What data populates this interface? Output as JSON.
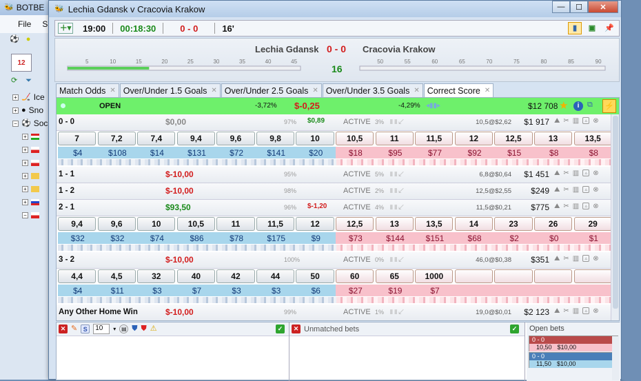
{
  "bg_window": {
    "title": "BOTBE",
    "menu": [
      "File",
      "S"
    ],
    "tree": [
      "Ice",
      "Sno",
      "Soc"
    ]
  },
  "window": {
    "title": "Lechia Gdansk v Cracovia Krakow",
    "min": "—",
    "max": "☐",
    "close": "✕"
  },
  "toolbar": {
    "start_time": "19:00",
    "elapsed": "00:18:30",
    "score": "0 - 0",
    "minute": "16'"
  },
  "scoreboard": {
    "home": "Lechia Gdansk",
    "score": "0 - 0",
    "away": "Cracovia Krakow",
    "minute": "16",
    "left_ticks": [
      "5",
      "10",
      "15",
      "20",
      "25",
      "30",
      "35",
      "40",
      "45"
    ],
    "right_ticks": [
      "50",
      "55",
      "60",
      "65",
      "70",
      "75",
      "80",
      "85",
      "90"
    ],
    "first_half_progress": 0.35,
    "second_half_progress": 0
  },
  "tabs": [
    {
      "label": "Match Odds"
    },
    {
      "label": "Over/Under 1.5 Goals"
    },
    {
      "label": "Over/Under 2.5 Goals"
    },
    {
      "label": "Over/Under 3.5 Goals"
    },
    {
      "label": "Correct Score",
      "active": true
    }
  ],
  "market_header": {
    "status": "OPEN",
    "back_pct": "-3,72%",
    "pl": "$-0,25",
    "lay_pct": "-4,29%",
    "matched": "$12 708"
  },
  "runners": [
    {
      "name": "0 - 0",
      "pl": "$0,00",
      "pct": "97%",
      "pl2": "$0,89",
      "status": "ACTIVE",
      "pct2": "3%",
      "last": "10,5@$2,62",
      "vol": "$1 917",
      "prices": [
        "7",
        "7,2",
        "7,4",
        "9,4",
        "9,6",
        "9,8",
        "10",
        "10,5",
        "11",
        "11,5",
        "12",
        "12,5",
        "13",
        "13,5"
      ],
      "sizes": [
        "$4",
        "$108",
        "$14",
        "$131",
        "$72",
        "$141",
        "$20",
        "$18",
        "$95",
        "$77",
        "$92",
        "$15",
        "$8",
        "$8"
      ]
    },
    {
      "name": "1 - 1",
      "pl": "$-10,00",
      "pct": "95%",
      "pl2": "",
      "status": "ACTIVE",
      "pct2": "5%",
      "last": "6,8@$0,64",
      "vol": "$1 451"
    },
    {
      "name": "1 - 2",
      "pl": "$-10,00",
      "pct": "98%",
      "pl2": "",
      "status": "ACTIVE",
      "pct2": "2%",
      "last": "12,5@$2,55",
      "vol": "$249"
    },
    {
      "name": "2 - 1",
      "pl": "$93,50",
      "pct": "96%",
      "pl2": "$-1,20",
      "status": "ACTIVE",
      "pct2": "4%",
      "last": "11,5@$0,21",
      "vol": "$775",
      "prices": [
        "9,4",
        "9,6",
        "10",
        "10,5",
        "11",
        "11,5",
        "12",
        "12,5",
        "13",
        "13,5",
        "14",
        "23",
        "26",
        "29"
      ],
      "sizes": [
        "$32",
        "$32",
        "$74",
        "$86",
        "$78",
        "$175",
        "$9",
        "$73",
        "$144",
        "$151",
        "$68",
        "$2",
        "$0",
        "$1"
      ]
    },
    {
      "name": "3 - 2",
      "pl": "$-10,00",
      "pct": "100%",
      "pl2": "",
      "status": "ACTIVE",
      "pct2": "0%",
      "last": "46,0@$0,38",
      "vol": "$351",
      "prices": [
        "4,4",
        "4,5",
        "32",
        "40",
        "42",
        "44",
        "50",
        "60",
        "65",
        "1000",
        "",
        "",
        "",
        ""
      ],
      "sizes": [
        "$4",
        "$11",
        "$3",
        "$7",
        "$3",
        "$3",
        "$6",
        "$27",
        "$19",
        "$7",
        "",
        "",
        "",
        ""
      ]
    },
    {
      "name": "Any Other Home Win",
      "pl": "$-10,00",
      "pct": "99%",
      "pl2": "",
      "status": "ACTIVE",
      "pct2": "1%",
      "last": "19,0@$0,01",
      "vol": "$2 123"
    }
  ],
  "bottom": {
    "stake": "10",
    "unmatched_label": "Unmatched bets",
    "open_label": "Open bets",
    "open_bets": [
      {
        "sel": "0 - 0",
        "odds": "10,50",
        "stake": "$10,00",
        "color": "#b94a4a"
      },
      {
        "sel": "0 - 0",
        "odds": "11,50",
        "stake": "$10,00",
        "color": "#4a7fb8"
      }
    ]
  },
  "colors": {
    "profit": "#1a8a1a",
    "loss": "#d21c1c",
    "back": "#a8d6ec",
    "lay": "#f8c1cb",
    "open_green": "#6ef06b"
  }
}
